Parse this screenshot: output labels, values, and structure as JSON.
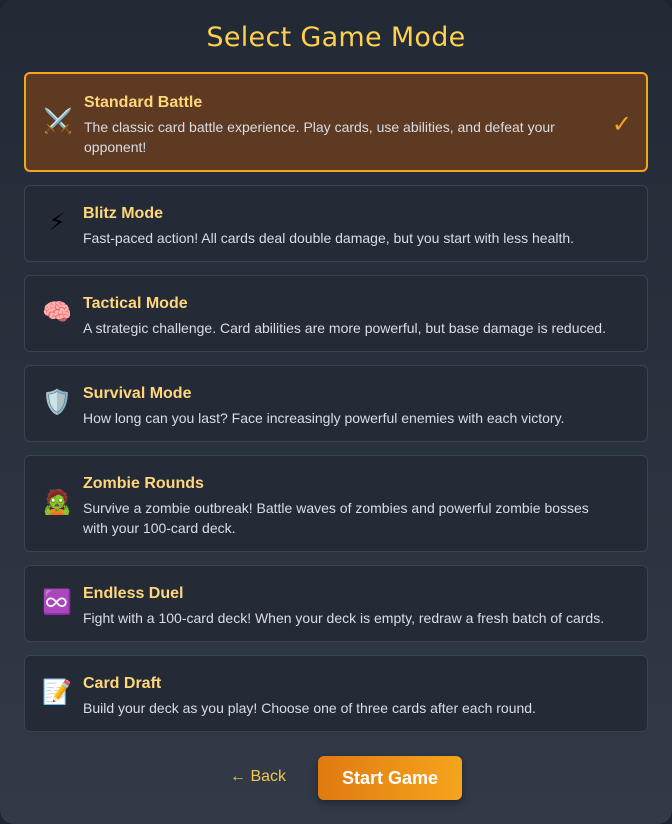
{
  "title": "Select Game Mode",
  "modes": [
    {
      "icon": "⚔️",
      "icon_name": "crossed-swords-icon",
      "name": "Standard Battle",
      "description": "The classic card battle experience. Play cards, use abilities, and defeat your opponent!",
      "selected": true
    },
    {
      "icon": "⚡",
      "icon_name": "lightning-icon",
      "name": "Blitz Mode",
      "description": "Fast-paced action! All cards deal double damage, but you start with less health.",
      "selected": false
    },
    {
      "icon": "🧠",
      "icon_name": "brain-icon",
      "name": "Tactical Mode",
      "description": "A strategic challenge. Card abilities are more powerful, but base damage is reduced.",
      "selected": false
    },
    {
      "icon": "🛡️",
      "icon_name": "shield-icon",
      "name": "Survival Mode",
      "description": "How long can you last? Face increasingly powerful enemies with each victory.",
      "selected": false
    },
    {
      "icon": "🧟",
      "icon_name": "zombie-icon",
      "name": "Zombie Rounds",
      "description": "Survive a zombie outbreak! Battle waves of zombies and powerful zombie bosses with your 100-card deck.",
      "selected": false
    },
    {
      "icon": "♾️",
      "icon_name": "infinity-icon",
      "name": "Endless Duel",
      "description": "Fight with a 100-card deck! When your deck is empty, redraw a fresh batch of cards.",
      "selected": false
    },
    {
      "icon": "📝",
      "icon_name": "memo-icon",
      "name": "Card Draft",
      "description": "Build your deck as you play! Choose one of three cards after each round.",
      "selected": false
    }
  ],
  "selected_check": "✓",
  "footer": {
    "back_label": "← Back",
    "start_label": "Start Game"
  },
  "colors": {
    "accent": "#f5a51d",
    "title": "#ffd04d",
    "selected_bg": "#5f3a22",
    "card_bg": "#242b37"
  }
}
